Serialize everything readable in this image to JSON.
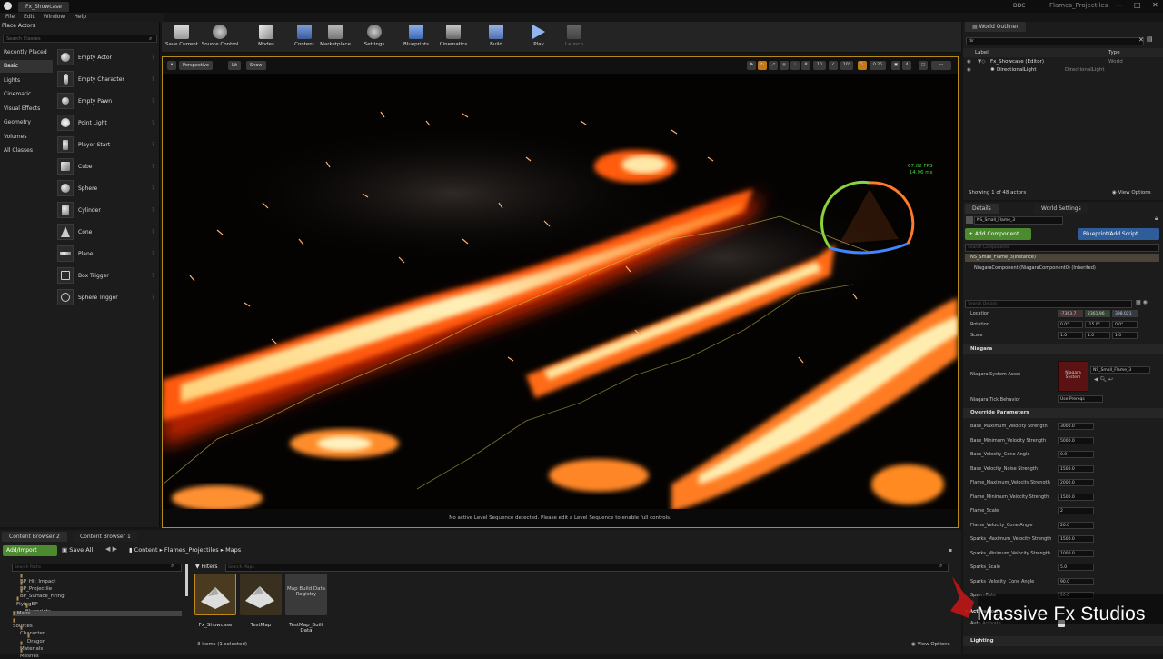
{
  "titlebar": {
    "tab": "Fx_Showcase",
    "ddc": "DDC",
    "project": "Flames_Projectiles"
  },
  "menu": [
    "File",
    "Edit",
    "Window",
    "Help"
  ],
  "place_actors": {
    "tab": "Place Actors",
    "search_placeholder": "Search Classes",
    "categories": [
      "Recently Placed",
      "Basic",
      "Lights",
      "Cinematic",
      "Visual Effects",
      "Geometry",
      "Volumes",
      "All Classes"
    ],
    "selected_category": "Basic",
    "actors": [
      "Empty Actor",
      "Empty Character",
      "Empty Pawn",
      "Point Light",
      "Player Start",
      "Cube",
      "Sphere",
      "Cylinder",
      "Cone",
      "Plane",
      "Box Trigger",
      "Sphere Trigger"
    ]
  },
  "toolbar": [
    "Save Current",
    "Source Control",
    "Modes",
    "Content",
    "Marketplace",
    "Settings",
    "Blueprints",
    "Cinematics",
    "Build",
    "Play",
    "Launch"
  ],
  "viewport": {
    "perspective": "Perspective",
    "lit": "Lit",
    "show": "Show",
    "snap_grid": "10",
    "snap_rot": "10°",
    "snap_scale": "0.25",
    "cam_speed": "4",
    "fps": "67.02 FPS",
    "ms": "14.96 ms",
    "sequence_msg": "No active Level Sequence detected. Please edit a Level Sequence to enable full controls."
  },
  "outliner": {
    "tab": "World Outliner",
    "search": "dir",
    "col_label": "Label",
    "col_type": "Type",
    "rows": [
      {
        "label": "Fx_Showcase (Editor)",
        "type": "World"
      },
      {
        "label": "DirectionalLight",
        "type": "DirectionalLight"
      }
    ],
    "status": "Showing 1 of 48 actors",
    "view_options": "View Options"
  },
  "details": {
    "tab_details": "Details",
    "tab_world": "World Settings",
    "name": "NS_Small_Flame_3",
    "add_component": "+ Add Component",
    "blueprint": "Blueprint/Add Script",
    "search_components": "Search Components",
    "instance": "NS_Small_Flame_3(Instance)",
    "component": "NiagaraComponent (NiagaraComponent0) (Inherited)",
    "search_details": "Search Details",
    "transform": [
      {
        "label": "Location",
        "values": [
          "-7363.7",
          "2361.96",
          "398.021"
        ]
      },
      {
        "label": "Rotation",
        "values": [
          "0.0°",
          "-15.0°",
          "0.0°"
        ]
      },
      {
        "label": "Scale",
        "values": [
          "1.0",
          "1.0",
          "1.0"
        ]
      }
    ],
    "section_niagara": "Niagara",
    "system_asset_label": "Niagara System Asset",
    "system_asset_thumb": "Niagara System",
    "system_asset_value": "NS_Small_Flame_3",
    "tick_label": "Niagara Tick Behavior",
    "tick_value": "Use Prereqs",
    "section_override": "Override Parameters",
    "params": [
      {
        "label": "Base_Maximum_Velocity Strength",
        "value": "3000.0"
      },
      {
        "label": "Base_Minimum_Velocity Strength",
        "value": "5000.0"
      },
      {
        "label": "Base_Velocity_Cone Angle",
        "value": "0.0"
      },
      {
        "label": "Base_Velocity_Noise Strength",
        "value": "1500.0"
      },
      {
        "label": "Flame_Maximum_Velocity Strength",
        "value": "2000.0"
      },
      {
        "label": "Flame_Minimum_Velocity Strength",
        "value": "1500.0"
      },
      {
        "label": "Flame_Scale",
        "value": "2"
      },
      {
        "label": "Flame_Velocity_Cone Angle",
        "value": "20.0"
      },
      {
        "label": "Sparks_Maximum_Velocity Strength",
        "value": "1500.0"
      },
      {
        "label": "Sparks_Minimum_Velocity Strength",
        "value": "1000.0"
      },
      {
        "label": "Sparks_Scale",
        "value": "5.0"
      },
      {
        "label": "Sparks_Velocity_Cone Angle",
        "value": "90.0"
      },
      {
        "label": "SpawnRate",
        "value": "20.0"
      }
    ],
    "auto_activate": "Auto Activate",
    "section_activation": "Activation",
    "section_lighting": "Lighting"
  },
  "content_browser": {
    "tab1": "Content Browser 2",
    "tab2": "Content Browser 1",
    "add_import": "Add/Import",
    "save_all": "Save All",
    "breadcrumb": [
      "Content",
      "Flames_Projectiles",
      "Maps"
    ],
    "search_paths": "Search Paths",
    "filters": "Filters",
    "search_maps": "Search Maps",
    "tree": [
      "BP_Hit_Impact",
      "BP_Projectile",
      "BP_Surface_Firing",
      "FlyingBP",
      "Blueprints",
      "Maps",
      "Sources",
      "Character",
      "Dragon",
      "Materials",
      "Meshes"
    ],
    "assets": [
      {
        "name": "Fx_Showcase"
      },
      {
        "name": "TestMap"
      },
      {
        "name": "TestMap_Built Data",
        "thumb": "Map Build Data Registry"
      }
    ],
    "status": "3 items (1 selected)",
    "view_options": "View Options"
  },
  "watermark": "Massive Fx Studios"
}
